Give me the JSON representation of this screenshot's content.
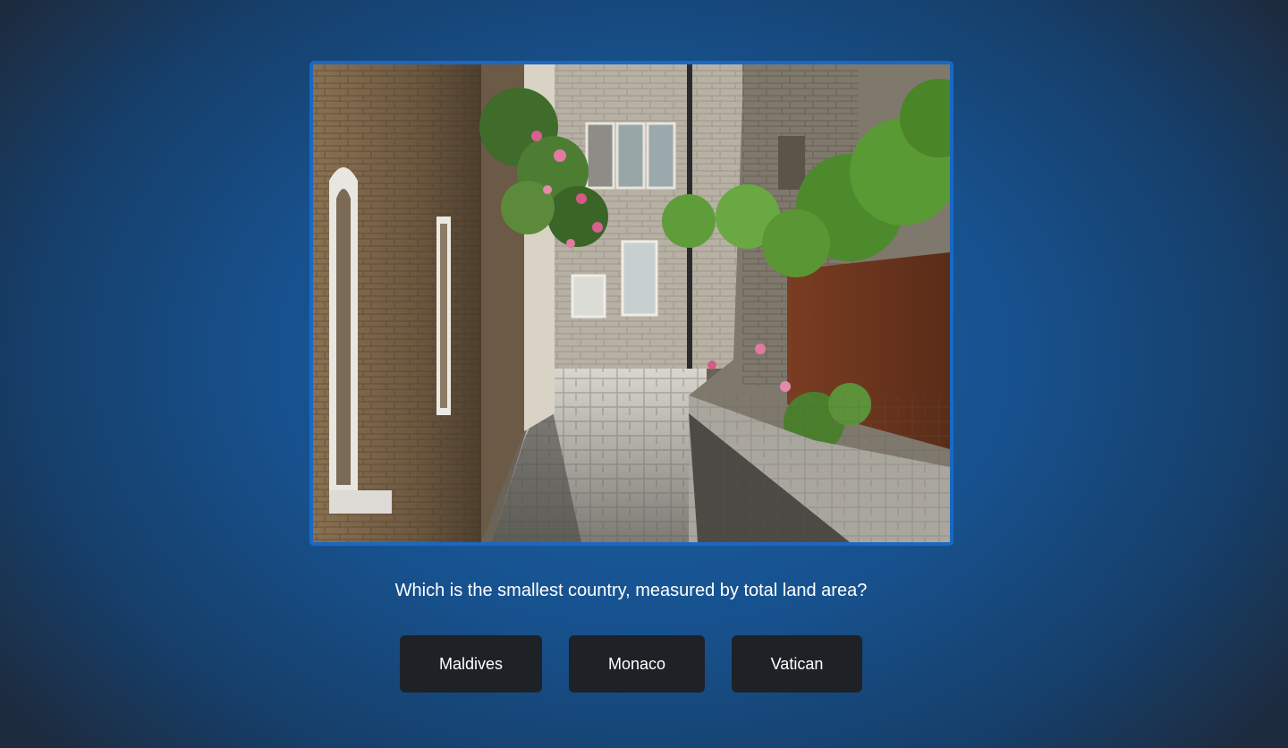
{
  "question": {
    "text": "Which is the smallest country, measured by total land area?"
  },
  "image": {
    "subject": "narrow-stone-alley-photo"
  },
  "answers": [
    {
      "label": "Maldives"
    },
    {
      "label": "Monaco"
    },
    {
      "label": "Vatican"
    }
  ],
  "colors": {
    "frame_border": "#1a68c2",
    "button_bg": "#1e2126",
    "text": "#ffffff"
  }
}
